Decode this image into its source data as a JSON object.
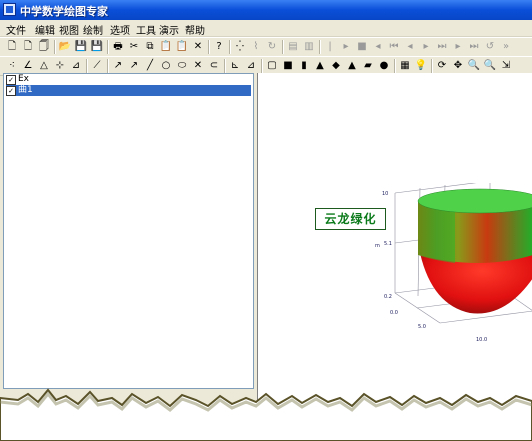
{
  "window": {
    "title": "中学数学绘图专家"
  },
  "menu": [
    "文件",
    "编辑",
    "视图",
    "绘制",
    "选项",
    "工具",
    "演示",
    "帮助"
  ],
  "toolbar1": [
    {
      "name": "new-file-icon",
      "glyph": "🗋"
    },
    {
      "name": "new-page-icon",
      "glyph": "🗋"
    },
    {
      "name": "template-icon",
      "glyph": "🗍"
    },
    {
      "name": "open-folder-icon",
      "glyph": "📂"
    },
    {
      "name": "save-icon",
      "glyph": "💾"
    },
    {
      "name": "save-all-icon",
      "glyph": "💾"
    },
    {
      "name": "print-icon",
      "glyph": "🖶"
    },
    {
      "name": "cut-icon",
      "glyph": "✂"
    },
    {
      "name": "copy-icon",
      "glyph": "⧉"
    },
    {
      "name": "paste-icon",
      "glyph": "📋"
    },
    {
      "name": "clipboard-icon",
      "glyph": "📋"
    },
    {
      "name": "delete-icon",
      "glyph": "✕"
    },
    {
      "name": "help-icon",
      "glyph": "?"
    },
    {
      "name": "scatter-icon",
      "glyph": "⁛"
    },
    {
      "name": "curve-edit-icon",
      "glyph": "⌇"
    },
    {
      "name": "redraw-icon",
      "glyph": "↻"
    },
    {
      "name": "chart-icon",
      "glyph": "▤"
    },
    {
      "name": "chart-edit-icon",
      "glyph": "▥"
    },
    {
      "name": "play-first-icon",
      "glyph": "|"
    },
    {
      "name": "play-icon",
      "glyph": "▸"
    },
    {
      "name": "stop-icon",
      "glyph": "■"
    },
    {
      "name": "step-back-icon",
      "glyph": "◂"
    },
    {
      "name": "rewind-icon",
      "glyph": "⏮"
    },
    {
      "name": "back-icon",
      "glyph": "◂"
    },
    {
      "name": "forward-icon",
      "glyph": "▸"
    },
    {
      "name": "fast-forward-icon",
      "glyph": "⏭"
    },
    {
      "name": "step-fwd-icon",
      "glyph": "▸"
    },
    {
      "name": "end-icon",
      "glyph": "⏭"
    },
    {
      "name": "loop-icon",
      "glyph": "↺"
    },
    {
      "name": "speed-icon",
      "glyph": "»"
    }
  ],
  "toolbar2": [
    {
      "name": "point-icon",
      "glyph": "⁖"
    },
    {
      "name": "angle-icon",
      "glyph": "∠"
    },
    {
      "name": "triangle-icon",
      "glyph": "△"
    },
    {
      "name": "point-on-line-icon",
      "glyph": "⊹"
    },
    {
      "name": "mark-icon",
      "glyph": "⊿"
    },
    {
      "name": "line-tool-icon",
      "glyph": "⟋"
    },
    {
      "name": "arrow-icon",
      "glyph": "↗"
    },
    {
      "name": "ray-icon",
      "glyph": "↗"
    },
    {
      "name": "segment-icon",
      "glyph": "╱"
    },
    {
      "name": "circle-icon",
      "glyph": "○"
    },
    {
      "name": "ellipse-icon",
      "glyph": "⬭"
    },
    {
      "name": "cross-icon",
      "glyph": "✕"
    },
    {
      "name": "arc-icon",
      "glyph": "⊂"
    },
    {
      "name": "polyline-icon",
      "glyph": "⊾"
    },
    {
      "name": "polygon-icon",
      "glyph": "⊿"
    },
    {
      "name": "cube-outline-icon",
      "glyph": "▢"
    },
    {
      "name": "cube-icon",
      "glyph": "■"
    },
    {
      "name": "cylinder-icon",
      "glyph": "▮"
    },
    {
      "name": "cone-icon",
      "glyph": "▲"
    },
    {
      "name": "prism-icon",
      "glyph": "◆"
    },
    {
      "name": "pyramid-icon",
      "glyph": "▲"
    },
    {
      "name": "frustum-icon",
      "glyph": "▰"
    },
    {
      "name": "sphere-icon",
      "glyph": "●"
    },
    {
      "name": "grid-icon",
      "glyph": "▦"
    },
    {
      "name": "bulb-icon",
      "glyph": "💡"
    },
    {
      "name": "rotate-3d-icon",
      "glyph": "⟳"
    },
    {
      "name": "move-icon",
      "glyph": "✥"
    },
    {
      "name": "zoom-in-icon",
      "glyph": "🔍"
    },
    {
      "name": "zoom-out-icon",
      "glyph": "🔍"
    },
    {
      "name": "scale-icon",
      "glyph": "⇲"
    }
  ],
  "tree": {
    "items": [
      {
        "label": "Ex",
        "checked": "✓"
      },
      {
        "label": "曲1",
        "checked": "✓"
      }
    ]
  },
  "banner": {
    "text": "云龙绿化"
  },
  "plot": {
    "z_ticks": [
      "10",
      "5.1",
      "0.2"
    ],
    "z_label": "m",
    "x_ticks": [
      "0.0",
      "5.0",
      "10.0"
    ],
    "colors": {
      "top": "#3bbf3b",
      "bottom": "#e01010",
      "side_dark": "#4a7a10"
    }
  }
}
